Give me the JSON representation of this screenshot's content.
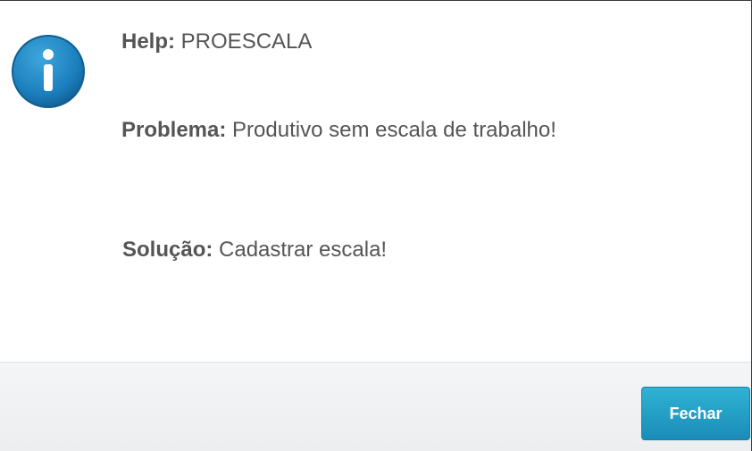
{
  "dialog": {
    "help_label": "Help:",
    "help_value": "PROESCALA",
    "problem_label": "Problema:",
    "problem_value": "Produtivo sem escala de trabalho!",
    "solution_label": "Solução:",
    "solution_value": "Cadastrar escala!",
    "icon": "info-icon"
  },
  "footer": {
    "close_label": "Fechar"
  },
  "colors": {
    "icon_fill": "#1b86c0",
    "button_top": "#2fb3d3",
    "button_bottom": "#1a8cb8",
    "text": "#555555"
  }
}
